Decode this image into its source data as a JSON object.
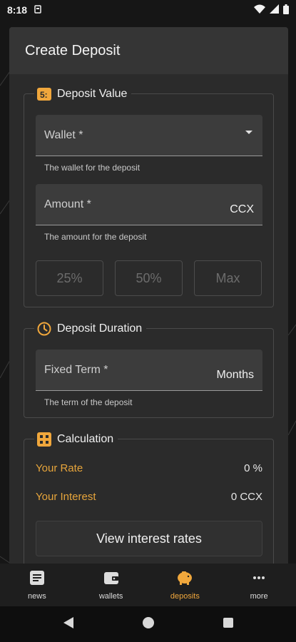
{
  "status_bar": {
    "time": "8:18"
  },
  "header": {
    "title": "Create Deposit"
  },
  "deposit_value": {
    "title": "Deposit Value",
    "wallet": {
      "label": "Wallet *",
      "helper": "The wallet for the deposit"
    },
    "amount": {
      "label": "Amount *",
      "suffix": "CCX",
      "helper": "The amount for the deposit"
    },
    "quick_buttons": [
      "25%",
      "50%",
      "Max"
    ]
  },
  "deposit_duration": {
    "title": "Deposit Duration",
    "term": {
      "label": "Fixed Term *",
      "suffix": "Months",
      "helper": "The term of the deposit"
    }
  },
  "calculation": {
    "title": "Calculation",
    "rate_label": "Your Rate",
    "rate_value": "0 %",
    "interest_label": "Your Interest",
    "interest_value": "0 CCX",
    "rates_button": "View interest rates"
  },
  "bottom_nav": {
    "items": [
      {
        "label": "news",
        "icon": "news-icon"
      },
      {
        "label": "wallets",
        "icon": "wallet-icon"
      },
      {
        "label": "deposits",
        "icon": "piggy-bank-icon",
        "active": true
      },
      {
        "label": "more",
        "icon": "more-icon"
      }
    ]
  },
  "colors": {
    "accent": "#f0a73c",
    "background": "#161616",
    "card": "#2b2b2b"
  }
}
